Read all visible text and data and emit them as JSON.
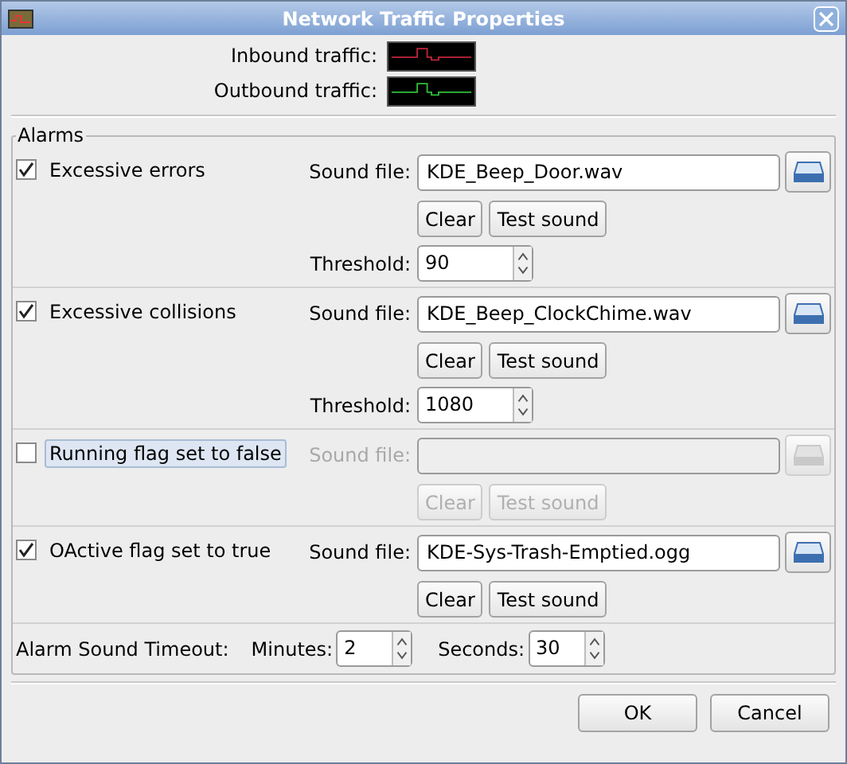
{
  "window": {
    "title": "Network Traffic Properties"
  },
  "traffic": [
    {
      "label": "Inbound traffic:",
      "kind": "inbound"
    },
    {
      "label": "Outbound traffic:",
      "kind": "outbound"
    }
  ],
  "alarms_group": {
    "title": "Alarms",
    "alarms": [
      {
        "label": "Excessive errors",
        "checked": true,
        "focused": false,
        "sound_label": "Sound file:",
        "sound_file": "KDE_Beep_Door.wav",
        "clear": "Clear",
        "test": "Test sound",
        "threshold_label": "Threshold:",
        "threshold": "90"
      },
      {
        "label": "Excessive collisions",
        "checked": true,
        "focused": false,
        "sound_label": "Sound file:",
        "sound_file": "KDE_Beep_ClockChime.wav",
        "clear": "Clear",
        "test": "Test sound",
        "threshold_label": "Threshold:",
        "threshold": "1080"
      },
      {
        "label": "Running flag set to false",
        "checked": false,
        "focused": true,
        "sound_label": "Sound file:",
        "clear": "Clear",
        "test": "Test sound"
      },
      {
        "label": "OActive flag set to true",
        "checked": true,
        "focused": false,
        "sound_label": "Sound file:",
        "sound_file": "KDE-Sys-Trash-Emptied.ogg",
        "clear": "Clear",
        "test": "Test sound"
      }
    ],
    "timeout": {
      "label": "Alarm Sound Timeout:",
      "minutes_label": "Minutes:",
      "minutes": "2",
      "seconds_label": "Seconds:",
      "seconds": "30"
    }
  },
  "buttons": [
    "OK",
    "Cancel"
  ]
}
